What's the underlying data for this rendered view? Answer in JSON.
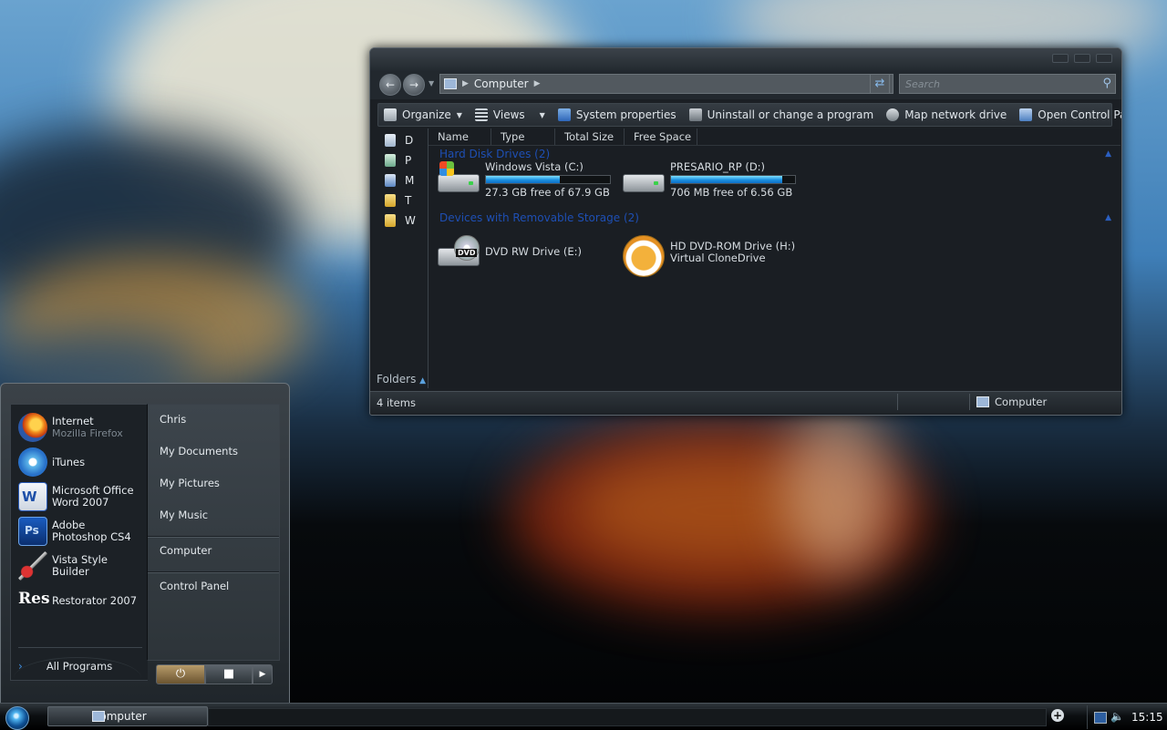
{
  "explorer": {
    "address": {
      "location": "Computer"
    },
    "search": {
      "placeholder": "Search"
    },
    "command_bar": {
      "organize": "Organize",
      "views": "Views",
      "system_properties": "System properties",
      "uninstall": "Uninstall or change a program",
      "map_network": "Map network drive",
      "control_panel": "Open Control Panel"
    },
    "nav_pane": {
      "items": [
        {
          "label": "D",
          "icon": "documents-folder-icon"
        },
        {
          "label": "P",
          "icon": "pictures-folder-icon"
        },
        {
          "label": "M",
          "icon": "music-folder-icon"
        },
        {
          "label": "T",
          "icon": "folder-icon"
        },
        {
          "label": "W",
          "icon": "folder-icon"
        }
      ],
      "folders_label": "Folders"
    },
    "columns": [
      "Name",
      "Type",
      "Total Size",
      "Free Space"
    ],
    "groups": {
      "hard_disks": {
        "title": "Hard Disk Drives (2)",
        "drives": [
          {
            "name": "Windows Vista (C:)",
            "free_text": "27.3 GB free of 67.9 GB",
            "used_fraction": 0.598,
            "icon": "windows-drive-icon"
          },
          {
            "name": "PRESARIO_RP (D:)",
            "free_text": "706 MB free of 6.56 GB",
            "used_fraction": 0.895,
            "icon": "hard-drive-icon"
          }
        ]
      },
      "removable": {
        "title": "Devices with Removable Storage (2)",
        "drives": [
          {
            "name": "DVD RW Drive (E:)",
            "sub": "",
            "icon": "dvd-drive-icon",
            "badge": "DVD"
          },
          {
            "name": "HD DVD-ROM Drive (H:)",
            "sub": "Virtual CloneDrive",
            "icon": "clonedrive-sheep-icon"
          }
        ]
      }
    },
    "status": {
      "items": "4 items",
      "location": "Computer"
    }
  },
  "start_menu": {
    "programs": [
      {
        "title": "Internet",
        "subtitle": "Mozilla Firefox",
        "icon": "firefox-icon"
      },
      {
        "title": "iTunes",
        "subtitle": "",
        "icon": "itunes-icon"
      },
      {
        "title": "Microsoft Office Word 2007",
        "subtitle": "",
        "icon": "word-icon"
      },
      {
        "title": "Adobe Photoshop CS4",
        "subtitle": "",
        "icon": "photoshop-icon"
      },
      {
        "title": "Vista Style Builder",
        "subtitle": "",
        "icon": "vista-style-builder-icon"
      },
      {
        "title": "Restorator 2007",
        "subtitle": "",
        "icon": "restorator-icon"
      }
    ],
    "all_programs": "All Programs",
    "links": [
      "Chris",
      "My Documents",
      "My Pictures",
      "My Music",
      "Computer",
      "Control Panel"
    ]
  },
  "taskbar": {
    "window_button": "Computer",
    "clock": "15:15"
  },
  "colors": {
    "group_header": "#1e4fb4",
    "progress_fill": "#1a8fe0",
    "window_bg": "#1b1f24"
  }
}
